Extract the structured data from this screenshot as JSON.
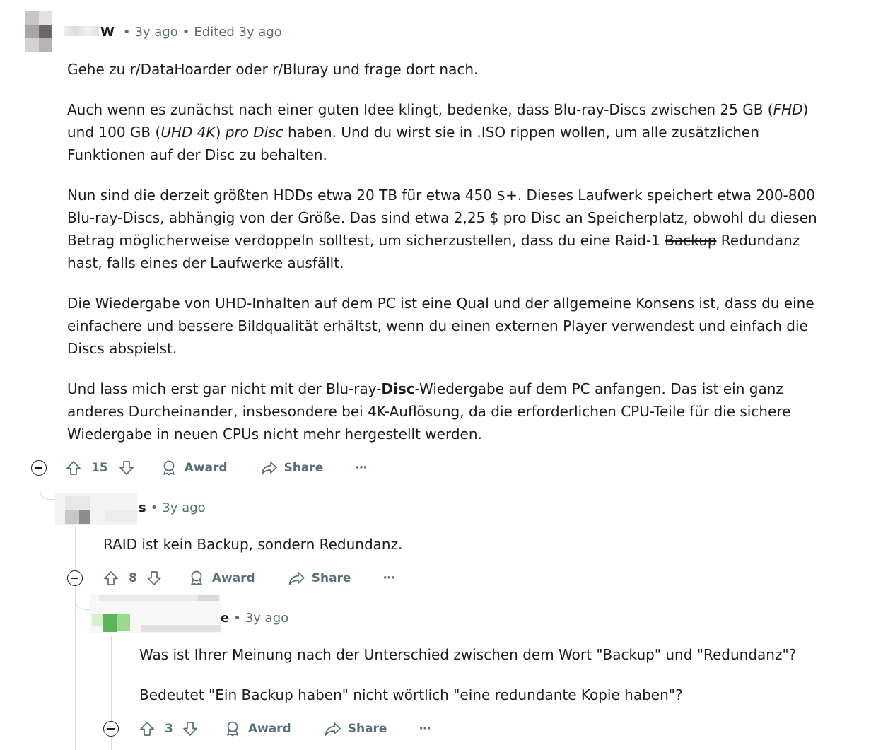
{
  "comments": [
    {
      "username_suffix": "W",
      "time": "3y ago",
      "edited": "Edited 3y ago",
      "paragraphs": {
        "p1": "Gehe zu r/DataHoarder oder r/Bluray und frage dort nach.",
        "p2a": "Auch wenn es zunächst nach einer guten Idee klingt, bedenke, dass Blu-ray-Discs zwischen 25 GB (",
        "p2b": "FHD",
        "p2c": ") und 100 GB (",
        "p2d": "UHD 4K",
        "p2e": ") ",
        "p2f": "pro Disc",
        "p2g": " haben. Und du wirst sie in .ISO rippen wollen, um alle zusätzlichen Funktionen auf der Disc zu behalten.",
        "p3a": "Nun sind die derzeit größten HDDs etwa 20 TB für etwa 450 $+. Dieses Laufwerk speichert etwa 200-800 Blu-ray-Discs, abhängig von der Größe. Das sind etwa 2,25 $ pro Disc an Speicherplatz, obwohl du diesen Betrag möglicherweise verdoppeln solltest, um sicherzustellen, dass du eine Raid-1 ",
        "p3b": "Backup",
        "p3c": " Redundanz hast, falls eines der Laufwerke ausfällt.",
        "p4": "Die Wiedergabe von UHD-Inhalten auf dem PC ist eine Qual und der allgemeine Konsens ist, dass du eine einfachere und bessere Bildqualität erhältst, wenn du einen externen Player verwendest und einfach die Discs abspielst.",
        "p5a": "Und lass mich erst gar nicht mit der Blu-ray-",
        "p5b": "Disc",
        "p5c": "-Wiedergabe auf dem PC anfangen. Das ist ein ganz anderes Durcheinander, insbesondere bei 4K-Auflösung, da die erforderlichen CPU-Teile für die sichere Wiedergabe in neuen CPUs nicht mehr hergestellt werden."
      },
      "votes": "15"
    },
    {
      "username_suffix": "s",
      "time": "3y ago",
      "paragraphs": [
        "RAID ist kein Backup, sondern Redundanz."
      ],
      "votes": "8"
    },
    {
      "username_suffix": "e",
      "time": "3y ago",
      "paragraphs": [
        "Was ist Ihrer Meinung nach der Unterschied zwischen dem Wort \"Backup\" und \"Redundanz\"?",
        "Bedeutet \"Ein Backup haben\" nicht wörtlich \"eine redundante Kopie haben\"?"
      ],
      "votes": "3"
    }
  ],
  "actions": {
    "award": "Award",
    "share": "Share",
    "more": "···"
  },
  "icons": {
    "collapse": "collapse-icon",
    "upvote": "upvote-arrow-icon",
    "downvote": "downvote-arrow-icon",
    "award": "award-ribbon-icon",
    "share": "share-arrow-icon"
  },
  "colors": {
    "text": "#1c1c1c",
    "meta": "#576f76",
    "thread_line": "#d8dbde"
  }
}
